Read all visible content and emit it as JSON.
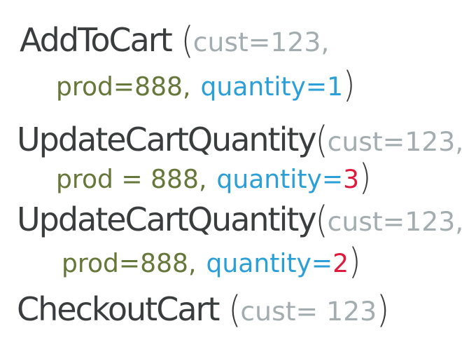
{
  "colors": {
    "function": "#3a3d3e",
    "cust": "#a3adb0",
    "prod": "#66773a",
    "quantity": "#2a9fd8",
    "changed_value": "#e01a3c"
  },
  "calls": [
    {
      "name": "AddToCart",
      "open": "(",
      "cust": "cust=123,",
      "prod": "prod=888,",
      "quantity_label": "quantity=",
      "quantity_value": "1",
      "close": ")"
    },
    {
      "name": "UpdateCartQuantity",
      "open": "(",
      "cust": "cust=123,",
      "prod": "prod = 888,",
      "quantity_label": "quantity=",
      "quantity_value": "3",
      "close": ")"
    },
    {
      "name": "UpdateCartQuantity",
      "open": "(",
      "cust": "cust=123,",
      "prod": "prod=888,",
      "quantity_label": "quantity=",
      "quantity_value": "2",
      "close": ")"
    },
    {
      "name": "CheckoutCart",
      "open": "(",
      "cust": "cust= 123",
      "close": ")"
    }
  ]
}
